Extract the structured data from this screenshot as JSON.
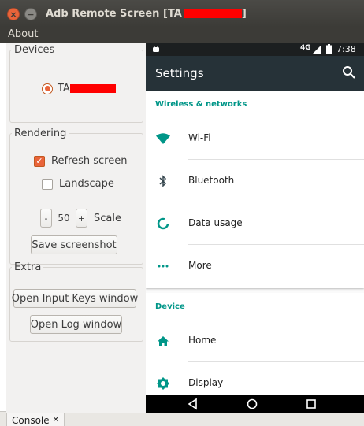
{
  "window": {
    "title": "Adb Remote Screen [TA",
    "title_close": "]",
    "close_glyph": "×",
    "min_glyph": "−"
  },
  "menu": {
    "about": "About"
  },
  "devices": {
    "legend": "Devices",
    "device_prefix": "TA"
  },
  "rendering": {
    "legend": "Rendering",
    "refresh_label": "Refresh screen",
    "refresh_checked": true,
    "landscape_label": "Landscape",
    "landscape_checked": false,
    "minus": "-",
    "scale_value": "50",
    "plus": "+",
    "scale_label": "Scale",
    "save_screenshot": "Save screenshot"
  },
  "extra": {
    "legend": "Extra",
    "open_input_keys": "Open Input Keys window",
    "open_log": "Open Log window"
  },
  "phone": {
    "status": {
      "network": "4G",
      "time": "7:38"
    },
    "appbar_title": "Settings",
    "sections": [
      {
        "header": "Wireless & networks",
        "items": [
          {
            "label": "Wi-Fi",
            "icon": "wifi-icon"
          },
          {
            "label": "Bluetooth",
            "icon": "bluetooth-icon"
          },
          {
            "label": "Data usage",
            "icon": "data-usage-icon"
          },
          {
            "label": "More",
            "icon": "more-dots-icon"
          }
        ]
      },
      {
        "header": "Device",
        "items": [
          {
            "label": "Home",
            "icon": "home-icon"
          },
          {
            "label": "Display",
            "icon": "display-brightness-icon"
          }
        ]
      }
    ],
    "accent_color": "#009688",
    "appbar_color": "#263238"
  },
  "background": {
    "console_tab": "Console",
    "console_close": "✕"
  },
  "colors": {
    "ubuntu_orange": "#e9643a",
    "titlebar": "#3c3b37",
    "redaction": "#ff0000"
  }
}
